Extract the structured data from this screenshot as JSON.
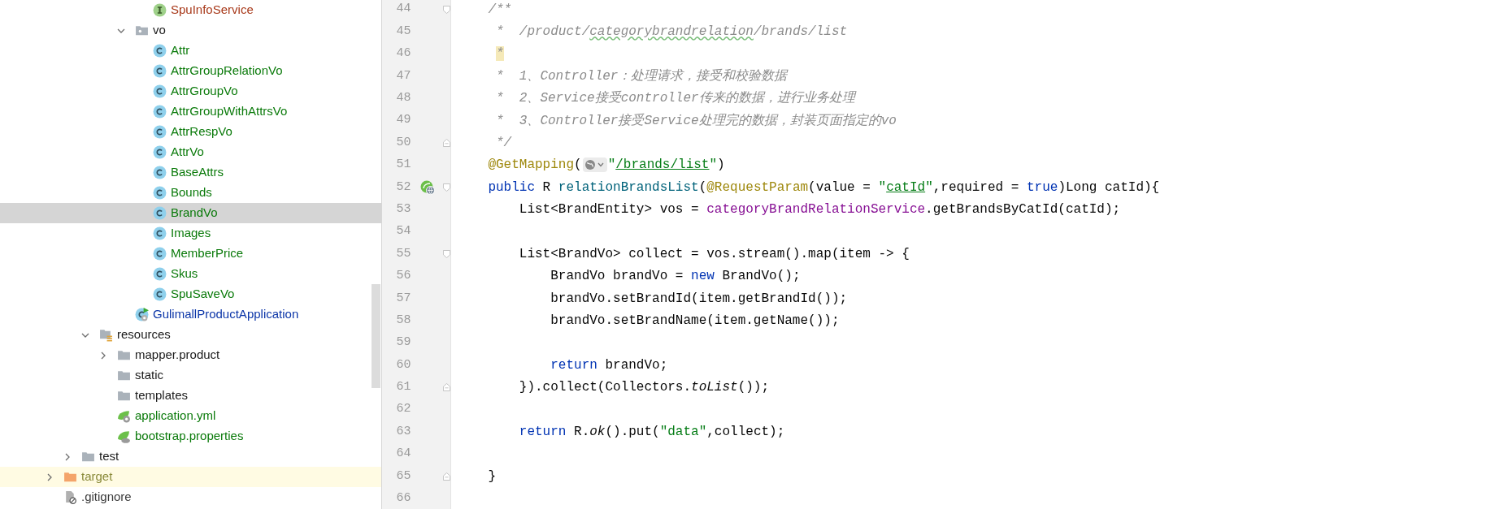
{
  "project_tree": {
    "items": [
      {
        "children": [
          {
            "children": [
              {
                "children": [
                  {
                    "children": [
                      {
                        "children": [
                          {
                            "name": "SpuInfoService",
                            "kind": "interface",
                            "color": "#a8391a",
                            "selected": false
                          }
                        ]
                      },
                      {
                        "name": "vo",
                        "kind": "package",
                        "color": "#1a1a1a",
                        "selected": false,
                        "expanded": true,
                        "children": [
                          {
                            "name": "Attr",
                            "kind": "class",
                            "color": "#0a7a0a",
                            "selected": false
                          },
                          {
                            "name": "AttrGroupRelationVo",
                            "kind": "class",
                            "color": "#0a7a0a",
                            "selected": false
                          },
                          {
                            "name": "AttrGroupVo",
                            "kind": "class",
                            "color": "#0a7a0a",
                            "selected": false
                          },
                          {
                            "name": "AttrGroupWithAttrsVo",
                            "kind": "class",
                            "color": "#0a7a0a",
                            "selected": false
                          },
                          {
                            "name": "AttrRespVo",
                            "kind": "class",
                            "color": "#0a7a0a",
                            "selected": false
                          },
                          {
                            "name": "AttrVo",
                            "kind": "class",
                            "color": "#0a7a0a",
                            "selected": false
                          },
                          {
                            "name": "BaseAttrs",
                            "kind": "class",
                            "color": "#0a7a0a",
                            "selected": false
                          },
                          {
                            "name": "Bounds",
                            "kind": "class",
                            "color": "#0a7a0a",
                            "selected": false
                          },
                          {
                            "name": "BrandVo",
                            "kind": "class",
                            "color": "#0a7a0a",
                            "selected": true
                          },
                          {
                            "name": "Images",
                            "kind": "class",
                            "color": "#0a7a0a",
                            "selected": false
                          },
                          {
                            "name": "MemberPrice",
                            "kind": "class",
                            "color": "#0a7a0a",
                            "selected": false
                          },
                          {
                            "name": "Skus",
                            "kind": "class",
                            "color": "#0a7a0a",
                            "selected": false
                          },
                          {
                            "name": "SpuSaveVo",
                            "kind": "class",
                            "color": "#0a7a0a",
                            "selected": false
                          }
                        ]
                      },
                      {
                        "name": "GulimallProductApplication",
                        "kind": "spring-app",
                        "color": "#0b35a8",
                        "selected": false
                      }
                    ]
                  }
                ]
              },
              {
                "name": "resources",
                "kind": "resources-folder",
                "color": "#1a1a1a",
                "selected": false,
                "expanded": true,
                "children": [
                  {
                    "name": "mapper.product",
                    "kind": "folder",
                    "color": "#1a1a1a",
                    "selected": false,
                    "expanded": false
                  },
                  {
                    "name": "static",
                    "kind": "folder",
                    "color": "#1a1a1a",
                    "selected": false
                  },
                  {
                    "name": "templates",
                    "kind": "folder",
                    "color": "#1a1a1a",
                    "selected": false
                  },
                  {
                    "name": "application.yml",
                    "kind": "spring-config",
                    "color": "#0a7a0a",
                    "selected": false
                  },
                  {
                    "name": "bootstrap.properties",
                    "kind": "spring-properties",
                    "color": "#0a7a0a",
                    "selected": false
                  }
                ]
              }
            ]
          },
          {
            "name": "test",
            "kind": "folder",
            "color": "#1a1a1a",
            "selected": false,
            "expanded": false
          }
        ]
      },
      {
        "name": "target",
        "kind": "excluded-folder",
        "color": "#8a8a3a",
        "selected": false,
        "expanded": false
      },
      {
        "name": ".gitignore",
        "kind": "ignore-file",
        "color": "#3a3a3a",
        "selected": false
      }
    ]
  },
  "editor": {
    "lines": [
      {
        "number": "44",
        "markers": [
          {
            "kind": "fold-start"
          }
        ],
        "tokens": [
          {
            "kind": "comment",
            "text": "    /**"
          }
        ]
      },
      {
        "number": "45",
        "tokens": [
          {
            "kind": "comment",
            "text": "     *  /product/"
          },
          {
            "kind": "comment-typo",
            "text": "categorybrandrelation"
          },
          {
            "kind": "comment",
            "text": "/brands/list"
          }
        ]
      },
      {
        "number": "46",
        "tokens": [
          {
            "kind": "comment-highlight",
            "text": "     *"
          }
        ]
      },
      {
        "number": "47",
        "tokens": [
          {
            "kind": "comment",
            "text": "     *  1、Controller：处理请求，接受和校验数据"
          }
        ]
      },
      {
        "number": "48",
        "tokens": [
          {
            "kind": "comment",
            "text": "     *  2、Service接受controller传来的数据，进行业务处理"
          }
        ]
      },
      {
        "number": "49",
        "tokens": [
          {
            "kind": "comment",
            "text": "     *  3、Controller接受Service处理完的数据，封装页面指定的vo"
          }
        ]
      },
      {
        "number": "50",
        "markers": [
          {
            "kind": "fold-end"
          }
        ],
        "tokens": [
          {
            "kind": "comment",
            "text": "     */"
          }
        ]
      },
      {
        "number": "51",
        "tokens": [
          {
            "kind": "annotation",
            "text": "    @GetMapping"
          },
          {
            "kind": "plain",
            "text": "("
          },
          {
            "kind": "url-inlay"
          },
          {
            "kind": "string",
            "text": "\""
          },
          {
            "kind": "string-link",
            "text": "/brands/list"
          },
          {
            "kind": "string",
            "text": "\""
          },
          {
            "kind": "plain",
            "text": ")"
          }
        ]
      },
      {
        "number": "52",
        "markers": [
          {
            "kind": "spring-web-bean"
          },
          {
            "kind": "fold-start"
          }
        ],
        "tokens": [
          {
            "kind": "keyword",
            "text": "    public"
          },
          {
            "kind": "plain",
            "text": " R "
          },
          {
            "kind": "method",
            "text": "relationBrandsList"
          },
          {
            "kind": "plain",
            "text": "("
          },
          {
            "kind": "annotation",
            "text": "@RequestParam"
          },
          {
            "kind": "plain",
            "text": "(value = "
          },
          {
            "kind": "string",
            "text": "\""
          },
          {
            "kind": "string-link",
            "text": "catId"
          },
          {
            "kind": "string",
            "text": "\""
          },
          {
            "kind": "plain",
            "text": ",required = "
          },
          {
            "kind": "keyword",
            "text": "true"
          },
          {
            "kind": "plain",
            "text": ")Long catId){"
          }
        ]
      },
      {
        "number": "53",
        "tokens": [
          {
            "kind": "plain",
            "text": "        List<BrandEntity> vos = "
          },
          {
            "kind": "field",
            "text": "categoryBrandRelationService"
          },
          {
            "kind": "plain",
            "text": ".getBrandsByCatId(catId);"
          }
        ]
      },
      {
        "number": "54"
      },
      {
        "number": "55",
        "markers": [
          {
            "kind": "fold-start"
          }
        ],
        "tokens": [
          {
            "kind": "plain",
            "text": "        List<BrandVo> collect = vos.stream().map(item -> {"
          }
        ]
      },
      {
        "number": "56",
        "tokens": [
          {
            "kind": "plain",
            "text": "            BrandVo brandVo = "
          },
          {
            "kind": "keyword",
            "text": "new"
          },
          {
            "kind": "plain",
            "text": " BrandVo();"
          }
        ]
      },
      {
        "number": "57",
        "tokens": [
          {
            "kind": "plain",
            "text": "            brandVo.setBrandId(item.getBrandId());"
          }
        ]
      },
      {
        "number": "58",
        "tokens": [
          {
            "kind": "plain",
            "text": "            brandVo.setBrandName(item.getName());"
          }
        ]
      },
      {
        "number": "59"
      },
      {
        "number": "60",
        "tokens": [
          {
            "kind": "keyword",
            "text": "            return"
          },
          {
            "kind": "plain",
            "text": " brandVo;"
          }
        ]
      },
      {
        "number": "61",
        "markers": [
          {
            "kind": "fold-end"
          }
        ],
        "tokens": [
          {
            "kind": "plain",
            "text": "        }).collect(Collectors."
          },
          {
            "kind": "static",
            "text": "toList"
          },
          {
            "kind": "plain",
            "text": "());"
          }
        ]
      },
      {
        "number": "62"
      },
      {
        "number": "63",
        "tokens": [
          {
            "kind": "keyword",
            "text": "        return"
          },
          {
            "kind": "plain",
            "text": " R."
          },
          {
            "kind": "static",
            "text": "ok"
          },
          {
            "kind": "plain",
            "text": "().put("
          },
          {
            "kind": "string",
            "text": "\"data\""
          },
          {
            "kind": "plain",
            "text": ",collect);"
          }
        ]
      },
      {
        "number": "64"
      },
      {
        "number": "65",
        "markers": [
          {
            "kind": "fold-end"
          }
        ],
        "tokens": [
          {
            "kind": "plain",
            "text": "    }"
          }
        ]
      },
      {
        "number": "66"
      }
    ]
  }
}
